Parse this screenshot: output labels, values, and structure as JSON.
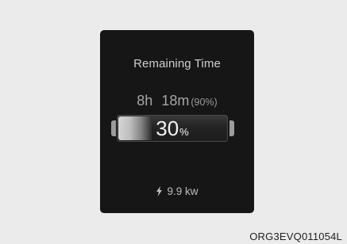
{
  "display": {
    "title": "Remaining Time",
    "time": {
      "hours": "8h",
      "minutes": "18m",
      "target": "(90%)"
    },
    "battery": {
      "level_value": "30",
      "level_unit": "%",
      "level_fraction": 0.3
    },
    "power": {
      "icon": "charging-bolt-icon",
      "value": "9.9 kw"
    }
  },
  "caption": "ORG3EVQ011054L",
  "colors": {
    "background": "#ebebeb",
    "panel": "#161616",
    "text_primary": "#f2f2f2",
    "text_secondary": "#a6a6a6"
  }
}
